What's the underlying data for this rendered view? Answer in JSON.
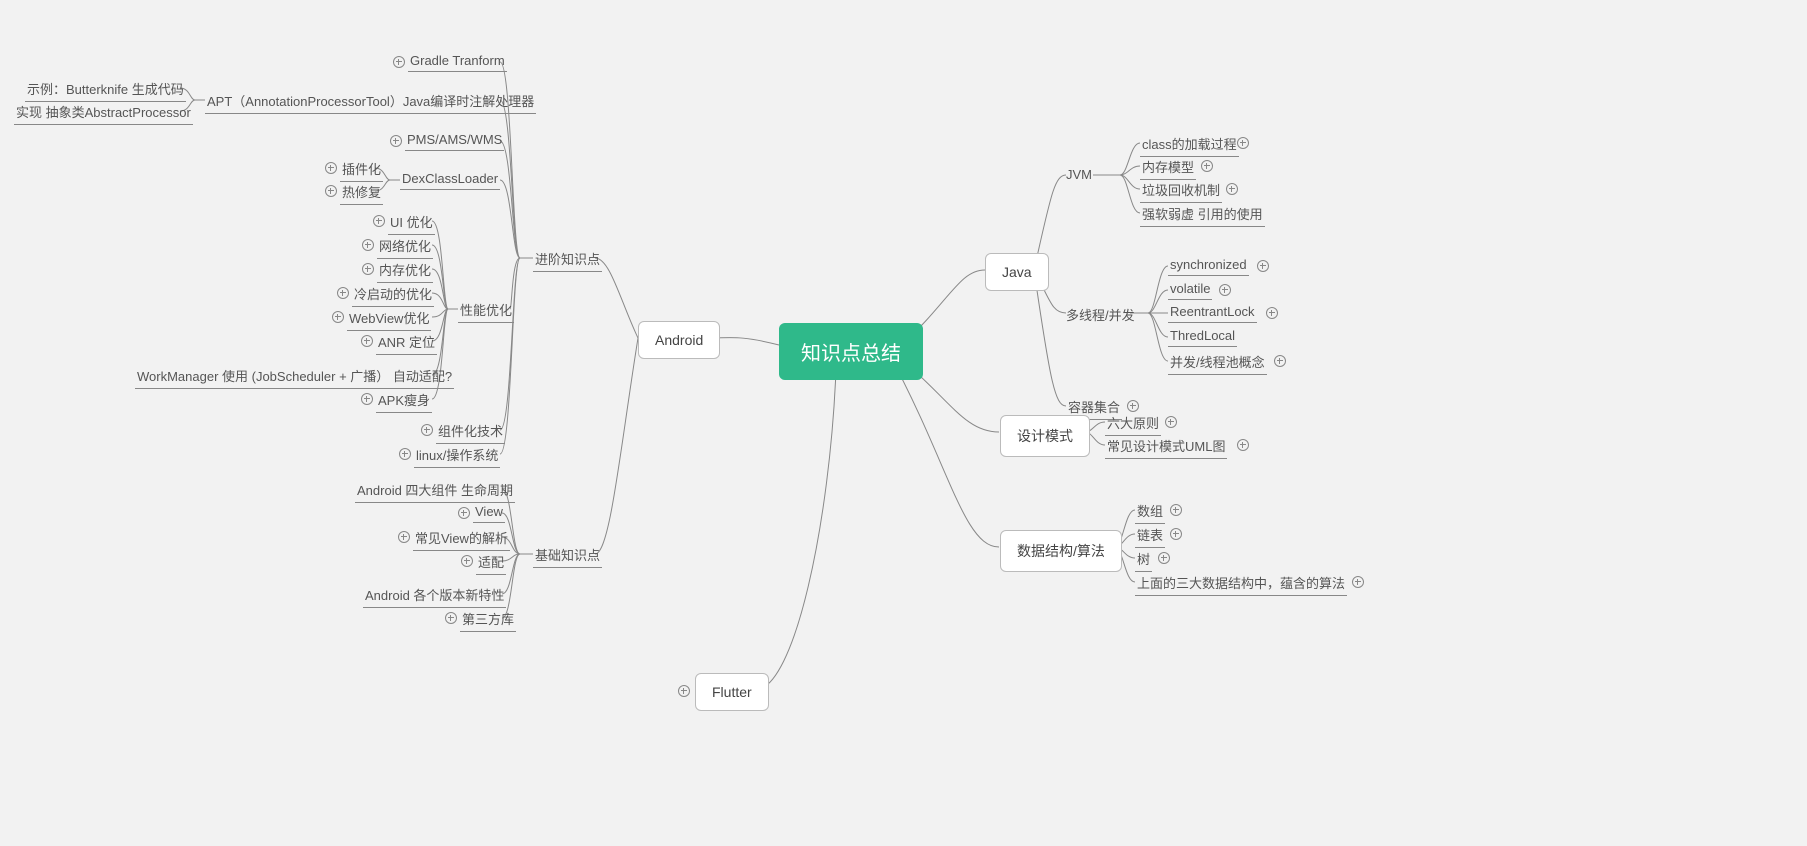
{
  "root": "知识点总结",
  "right": {
    "java": {
      "label": "Java",
      "jvm": {
        "label": "JVM",
        "items": [
          "class的加载过程",
          "内存模型",
          "垃圾回收机制",
          "强软弱虚 引用的使用"
        ]
      },
      "concurrency": {
        "label": "多线程/并发",
        "items": [
          "synchronized",
          "volatile",
          "ReentrantLock",
          "ThredLocal",
          "并发/线程池概念"
        ]
      },
      "collections": "容器集合"
    },
    "design": {
      "label": "设计模式",
      "items": [
        "六大原则",
        "常见设计模式UML图"
      ]
    },
    "ds": {
      "label": "数据结构/算法",
      "items": [
        "数组",
        "链表",
        "树",
        "上面的三大数据结构中，蕴含的算法"
      ]
    }
  },
  "left": {
    "android": {
      "label": "Android",
      "advanced": {
        "label": "进阶知识点",
        "gradle": "Gradle Tranform",
        "apt": {
          "label": "APT（AnnotationProcessorTool）Java编译时注解处理器",
          "items": [
            "示例：Butterknife 生成代码",
            "实现 抽象类AbstractProcessor"
          ]
        },
        "pms": "PMS/AMS/WMS",
        "dex": {
          "label": "DexClassLoader",
          "items": [
            "插件化",
            "热修复"
          ]
        },
        "perf": {
          "label": "性能优化",
          "items": [
            "UI 优化",
            "网络优化",
            "内存优化",
            "冷启动的优化",
            "WebView优化",
            "ANR 定位",
            "WorkManager 使用 (JobScheduler  +  广播） 自动适配?",
            "APK瘦身"
          ]
        },
        "component": "组件化技术",
        "linux": "linux/操作系统"
      },
      "basic": {
        "label": "基础知识点",
        "items": [
          "Android 四大组件 生命周期",
          "View",
          "常见View的解析",
          "适配",
          "Android  各个版本新特性",
          "第三方库"
        ]
      }
    },
    "flutter": "Flutter"
  }
}
